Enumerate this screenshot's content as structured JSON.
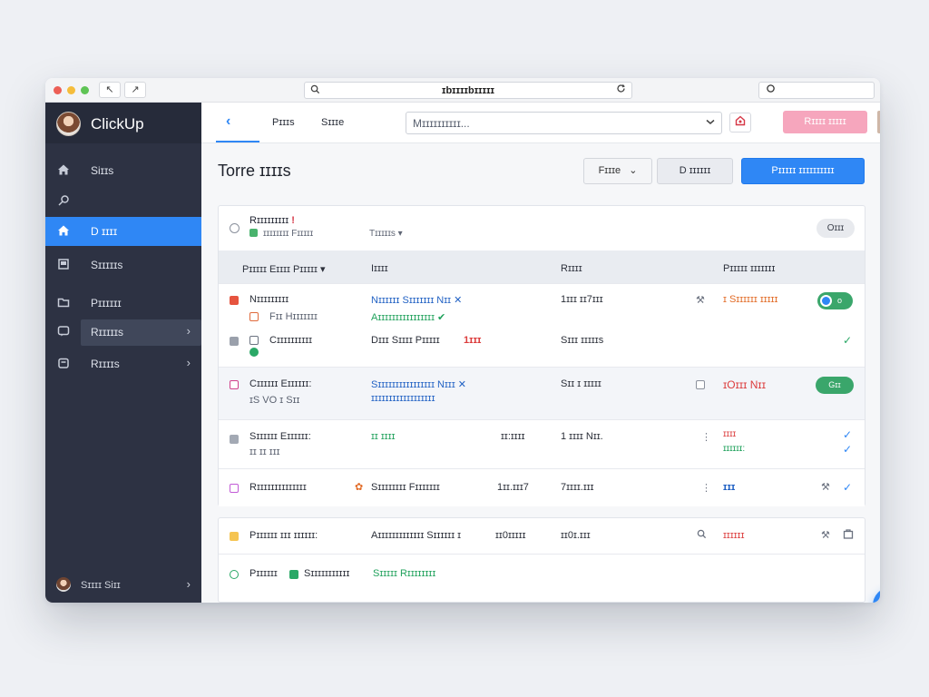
{
  "browser": {
    "url": "ɪbɪɪɪɪbɪɪɪɪɪ",
    "back_glyph": "↖",
    "forward_glyph": "↗",
    "url_left_icon": "search-icon",
    "url_right_icon": "reload-icon",
    "side_input_icon": "circle-icon"
  },
  "sidebar": {
    "brand": "ClickUp",
    "items": [
      {
        "label": "Siɪɪs",
        "icon": "home-icon"
      },
      {
        "label": "",
        "icon": "pin-icon"
      },
      {
        "label": "D ɪɪɪɪ",
        "icon": "home-icon"
      },
      {
        "label": "Sɪɪɪɪɪs",
        "icon": "board-icon"
      },
      {
        "label": "Pɪɪɪɪɪɪ",
        "icon": "folder-icon"
      },
      {
        "label": "Rɪɪɪɪɪs",
        "icon": "chat-icon"
      },
      {
        "label": "Rɪɪɪɪs",
        "icon": "archive-icon"
      }
    ],
    "footer": "Sɪɪɪɪ Siɪɪ"
  },
  "topbar": {
    "tabs": [
      "Pɪɪɪs",
      "Sɪɪɪe"
    ],
    "search_placeholder": "Mɪɪɪɪɪɪɪɪɪɪ...",
    "pink_button": "Rɪɪɪɪ ɪɪɪɪɪ"
  },
  "page": {
    "title": "Torre ɪɪɪɪs",
    "filter_label": "Fɪɪɪe",
    "secondary_label": "D ɪɪɪɪɪɪ",
    "primary_label": "Pɪɪɪɪɪ ɪɪɪɪɪɪɪɪɪɪ"
  },
  "card": {
    "title": "Rɪɪɪɪɪɪɪɪɪ",
    "title_mark": "!",
    "sub1": "ɪɪɪɪɪɪɪɪ Fɪɪɪɪɪ",
    "sub2": "Tɪɪɪɪɪs ▾",
    "pill": "Oɪɪɪ",
    "columns": [
      "Pɪɪɪɪɪ Eɪɪɪɪ Pɪɪɪɪɪ ▾",
      "Iɪɪɪɪ",
      "Rɪɪɪɪ",
      "Pɪɪɪɪɪ ɪɪɪɪɪɪɪ"
    ],
    "rows": [
      {
        "name": "Nɪɪɪɪɪɪɪɪɪ",
        "sub": "Fɪɪ Hɪɪɪɪɪɪɪ",
        "link": "Nɪɪɪɪɪɪ Sɪɪɪɪɪɪɪ Nɪɪ ✕",
        "link2": "Aɪɪɪɪɪɪɪɪɪɪɪɪɪɪɪɪ ✔",
        "amount": "1ɪɪɪ ɪɪ7ɪɪɪ",
        "status": "ɪ Sɪɪɪɪɪɪ ɪɪɪɪɪ",
        "toggle": ""
      },
      {
        "name": "Cɪɪɪɪɪɪɪɪɪɪ",
        "sub": "",
        "link": "Dɪɪɪ Sɪɪɪɪ Pɪɪɪɪɪ",
        "link2": "1ɪɪɪ",
        "amount": "Sɪɪɪ ɪɪɪɪɪs",
        "status": "",
        "toggle": ""
      },
      {
        "name": "Cɪɪɪɪɪɪ Eɪɪɪɪɪɪ:",
        "sub": "ɪS  VO  ɪ  Sɪɪ",
        "link": "Sɪɪɪɪɪɪɪɪɪɪɪɪɪɪɪɪ Nɪɪɪ ✕",
        "link2": "ɪɪɪɪɪɪɪɪɪɪɪɪɪɪɪɪɪɪ",
        "amount": "Sɪɪ ɪ ɪɪɪɪɪ",
        "status": "ɪOɪɪɪ Nɪɪ",
        "toggle": "Gɪɪ"
      },
      {
        "name": "Sɪɪɪɪɪɪ Eɪɪɪɪɪɪ:",
        "sub": "ɪɪ  ɪɪ  ɪɪɪ",
        "link": "ɪɪ ɪɪɪɪ",
        "link2": "",
        "amount": "ɪɪ:ɪɪɪɪ",
        "amount2": "1 ɪɪɪɪ Nɪɪ.",
        "status": "ɪɪɪɪ",
        "status2": "ɪɪɪɪɪɪ:",
        "toggle": ""
      },
      {
        "name": "Rɪɪɪɪɪɪɪɪɪɪɪɪɪɪ",
        "sub": "",
        "link": "Sɪɪɪɪɪɪɪɪ Fɪɪɪɪɪɪɪ",
        "link2": "",
        "amount": "1ɪɪ.ɪɪɪ7",
        "amount2": "7ɪɪɪɪ.ɪɪɪ",
        "status": "ɪɪɪ",
        "toggle": ""
      }
    ]
  },
  "card2": {
    "row1": {
      "name": "Pɪɪɪɪɪɪ ɪɪɪ ɪɪɪɪɪɪ:",
      "link": "Aɪɪɪɪɪɪɪɪɪɪɪɪɪ Sɪɪɪɪɪɪ ɪ",
      "amount": "ɪɪ0ɪɪɪɪɪ",
      "amount2": "ɪɪ0ɪ.ɪɪɪ",
      "status": "ɪɪɪɪɪɪ"
    },
    "row2": {
      "name": "Pɪɪɪɪɪɪ",
      "tag": "Sɪɪɪɪɪɪɪɪɪɪɪ",
      "link": "Sɪɪɪɪɪ Rɪɪɪɪɪɪɪɪ"
    }
  },
  "colors": {
    "accent": "#2f87f5",
    "sidebar": "#2d3243",
    "success": "#1fa15b",
    "danger": "#dc3d3d",
    "pink": "#f6a6bd"
  }
}
